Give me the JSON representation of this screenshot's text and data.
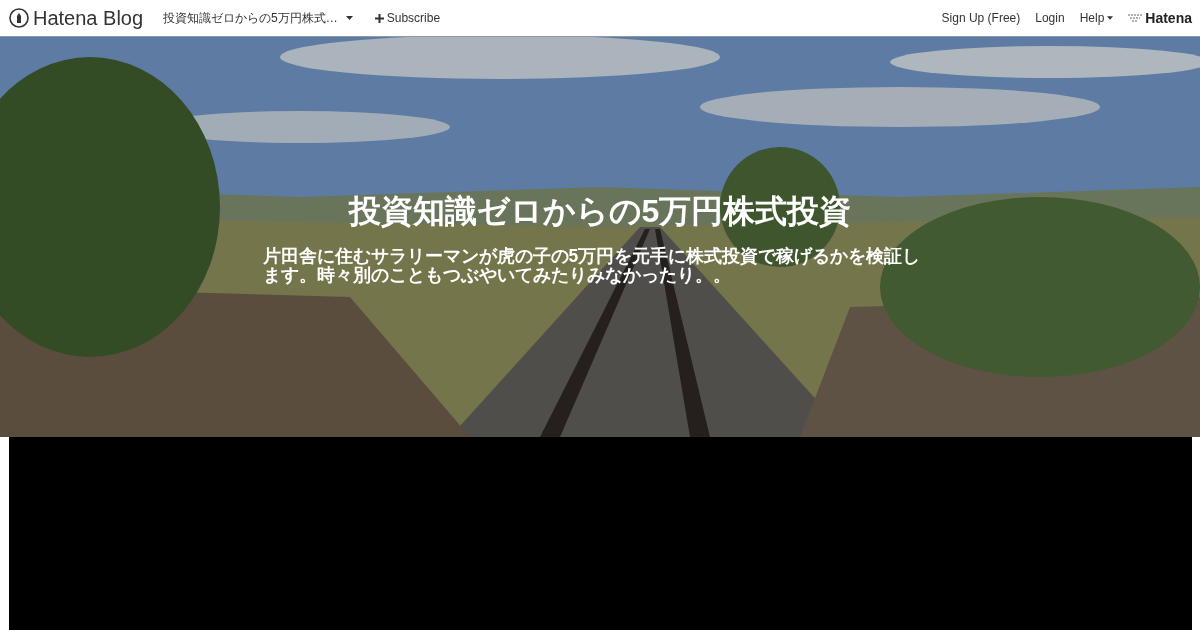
{
  "navbar": {
    "logo": "Hatena Blog",
    "blog_menu": "投資知識ゼロからの5万円株式…",
    "subscribe": "Subscribe",
    "links": [
      "Sign Up (Free)",
      "Login"
    ],
    "help": "Help",
    "brand": "Hatena"
  },
  "header": {
    "title": "投資知識ゼロからの5万円株式投資",
    "description": "片田舎に住むサラリーマンが虎の子の5万円を元手に株式投資で稼げるかを検証します。時々別のこともつぶやいてみたりみなかったり。。"
  }
}
